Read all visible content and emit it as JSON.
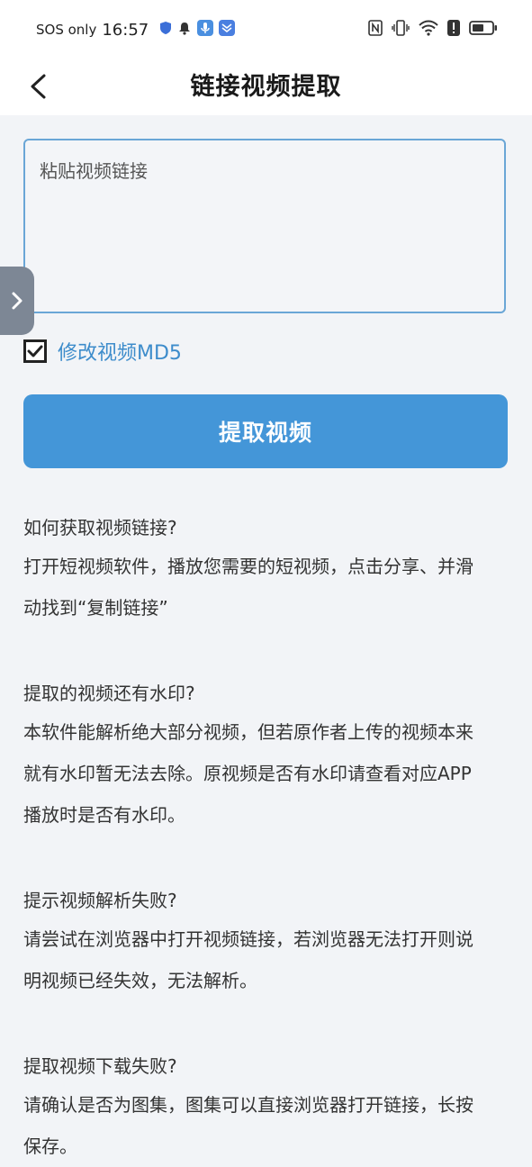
{
  "status": {
    "carrier": "SOS only",
    "time": "16:57"
  },
  "header": {
    "title": "链接视频提取"
  },
  "url_input": {
    "placeholder": "粘贴视频链接",
    "value": ""
  },
  "md5_option": {
    "label": "修改视频MD5",
    "checked": true
  },
  "extract_button": {
    "label": "提取视频"
  },
  "faq": [
    {
      "q": "如何获取视频链接?",
      "a": [
        "打开短视频软件，播放您需要的短视频，点击分享、并滑",
        "动找到“复制链接”"
      ]
    },
    {
      "q": "提取的视频还有水印?",
      "a": [
        "本软件能解析绝大部分视频，但若原作者上传的视频本来",
        "就有水印暂无法去除。原视频是否有水印请查看对应APP",
        "播放时是否有水印。"
      ]
    },
    {
      "q": "提示视频解析失败?",
      "a": [
        "请尝试在浏览器中打开视频链接，若浏览器无法打开则说",
        "明视频已经失效，无法解析。"
      ]
    },
    {
      "q": "提取视频下载失败?",
      "a": [
        "请确认是否为图集，图集可以直接浏览器打开链接，长按",
        "保存。"
      ]
    }
  ],
  "colors": {
    "accent": "#4496d8",
    "link": "#3d8ccb",
    "background": "#f2f4f7"
  }
}
